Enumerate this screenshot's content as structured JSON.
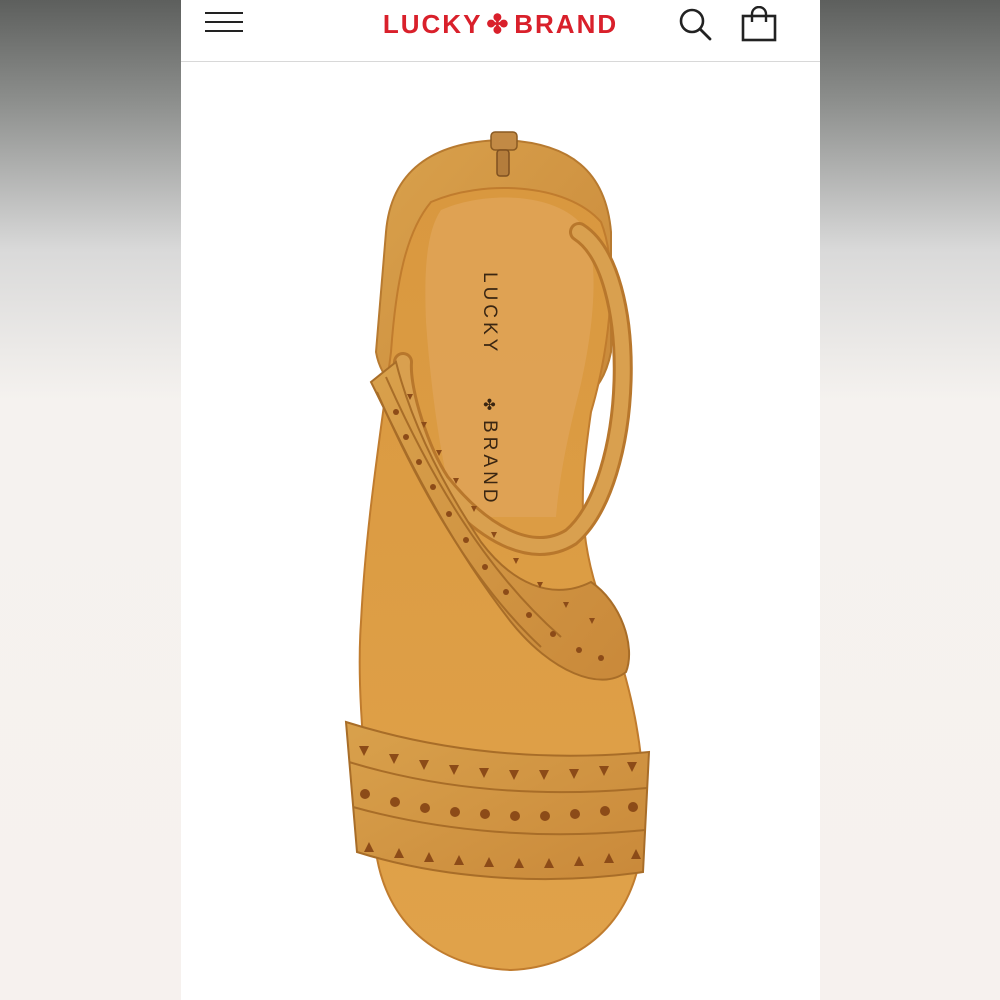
{
  "header": {
    "brand_left": "LUCKY",
    "brand_symbol": "✤",
    "brand_right": "BRAND",
    "brand_color": "#d9202b",
    "menu_icon": "hamburger-menu-icon",
    "search_icon": "search-icon",
    "bag_icon": "shopping-bag-icon"
  },
  "product_image": {
    "insole_brand_left": "LUCKY",
    "insole_brand_right": "BRAND",
    "leather_color": "#d49a45"
  }
}
